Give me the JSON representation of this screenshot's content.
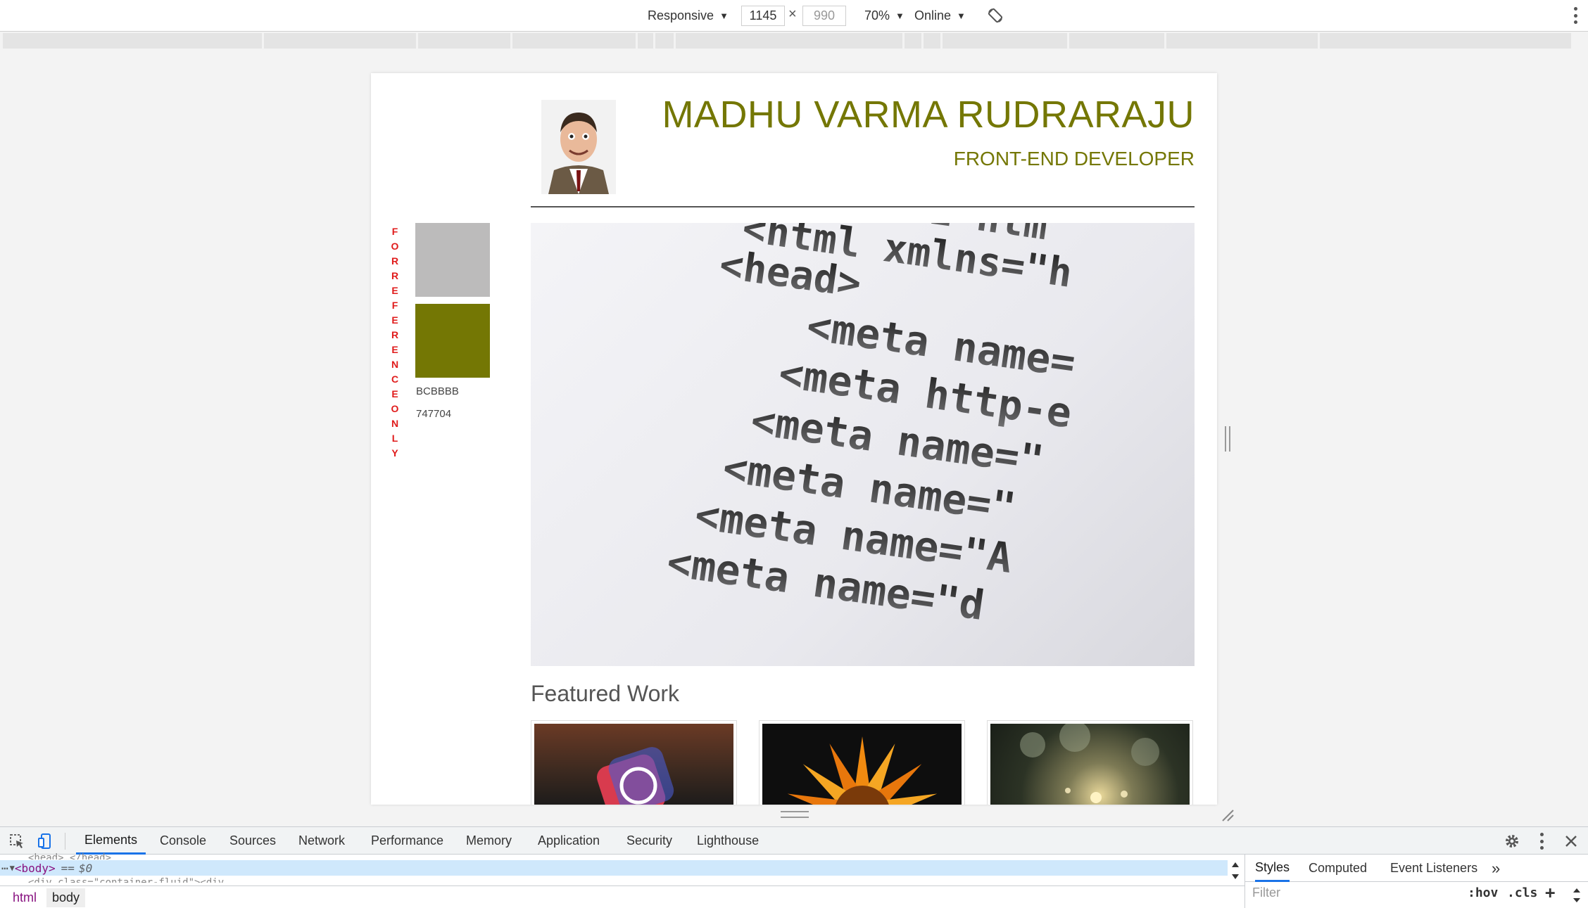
{
  "device_toolbar": {
    "device": "Responsive",
    "width": "1145",
    "height_placeholder": "990",
    "times": "×",
    "zoom": "70%",
    "throttle": "Online"
  },
  "page": {
    "name": "MADHU VARMA RUDRARAJU",
    "role": "FRONT-END DEVELOPER",
    "vertical_label": [
      "F",
      "O",
      "R",
      "R",
      "E",
      "F",
      "E",
      "R",
      "E",
      "N",
      "C",
      "E",
      "O",
      "N",
      "L",
      "Y"
    ],
    "swatch_1_label": "BCBBBB",
    "swatch_2_label": "747704",
    "featured_title": "Featured Work",
    "hero_code_lines": [
      "<!DOCTYPE htm",
      "<html xmlns=\"h",
      "<head>",
      "<meta name=",
      "<meta http-e",
      "<meta name=\"",
      "<meta name=\"",
      "<meta name=\"A",
      "<meta name=\"d"
    ]
  },
  "devtools": {
    "tabs": [
      "Elements",
      "Console",
      "Sources",
      "Network",
      "Performance",
      "Memory",
      "Application",
      "Security",
      "Lighthouse"
    ],
    "active_tab": "Elements",
    "dom_selected_tag": "<body>",
    "dom_eq": "==",
    "dom_var": "$0",
    "dom_line_above": "<head>…</head>",
    "dom_line_below": "<div class=\"container-fluid\"><div",
    "breadcrumbs": [
      "html",
      "body"
    ],
    "side_tabs": [
      "Styles",
      "Computed",
      "Event Listeners",
      "»"
    ],
    "filter_placeholder": "Filter",
    "hov": ":hov",
    "cls": ".cls",
    "plus": "+"
  },
  "colors": {
    "accent": "#747704",
    "swatch_gray": "#BCBBBB",
    "vertical_label": "#e01b1b",
    "devtools_active": "#1a73e8"
  }
}
